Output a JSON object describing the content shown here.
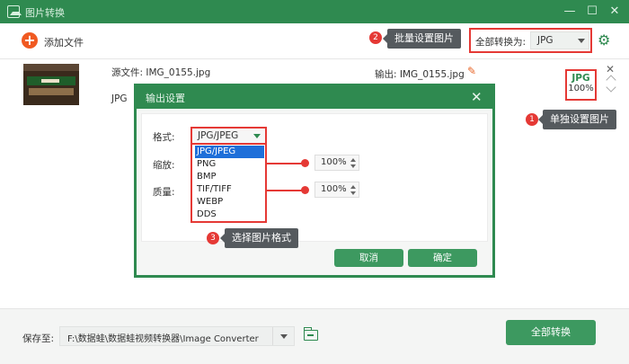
{
  "window": {
    "title": "图片转换",
    "minimize_icon": "minimize-icon",
    "maximize_icon": "maximize-icon",
    "close_icon": "close-icon"
  },
  "toolbar": {
    "add_file_label": "添加文件",
    "convert_all_label": "全部转换为:",
    "convert_all_format": "JPG",
    "settings_icon": "gear-icon"
  },
  "file": {
    "source_label": "源文件:",
    "source_name": "IMG_0155.jpg",
    "source_format": "JPG",
    "output_label": "输出:",
    "output_name": "IMG_0155.jpg",
    "status_format": "JPG",
    "status_percent": "100%"
  },
  "callouts": [
    {
      "number": "2",
      "text": "批量设置图片"
    },
    {
      "number": "1",
      "text": "单独设置图片"
    },
    {
      "number": "3",
      "text": "选择图片格式"
    }
  ],
  "dialog": {
    "title": "输出设置",
    "format_label": "格式:",
    "format_value": "JPG/JPEG",
    "format_options": [
      "JPG/JPEG",
      "PNG",
      "BMP",
      "TIF/TIFF",
      "WEBP",
      "DDS"
    ],
    "format_selected_index": 0,
    "scale_label": "缩放:",
    "scale_value": "100%",
    "quality_label": "质量:",
    "quality_value": "100%",
    "cancel_label": "取消",
    "ok_label": "确定"
  },
  "bottom": {
    "save_label": "保存至:",
    "path": "F:\\数据蛙\\数据蛙视频转换器\\Image Converter",
    "convert_button": "全部转换"
  },
  "colors": {
    "brand_green": "#2f8a50",
    "button_green": "#3d9960",
    "highlight_red": "#e53935",
    "add_orange": "#f05a22",
    "selection_blue": "#1e6fd9"
  }
}
